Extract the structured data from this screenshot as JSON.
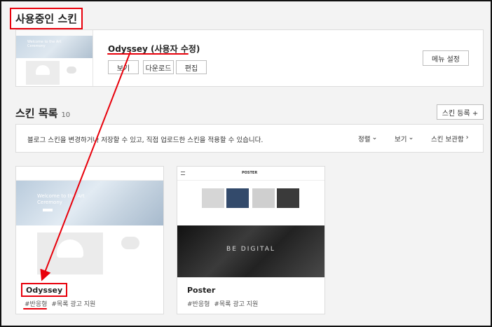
{
  "current": {
    "section_title": "사용중인 스킨",
    "skin_name": "Odyssey (사용자 수정)",
    "buttons": {
      "view": "보기",
      "download": "다운로드",
      "edit": "편집"
    },
    "menu_button": "메뉴 설정"
  },
  "thumb_text": {
    "hero": "Welcome to the Art Ceremony",
    "poster_hero": "BE DIGITAL",
    "poster_logo": "POSTER"
  },
  "list": {
    "title": "스킨 목록",
    "count": "10",
    "register_button": "스킨 등록 +",
    "info_text": "블로그 스킨을 변경하거나 저장할 수 있고, 직접 업로드한 스킨을 적용할 수 있습니다.",
    "sort": "정렬",
    "view": "보기",
    "storage": "스킨 보관함"
  },
  "skins": [
    {
      "name": "Odyssey",
      "tags": [
        "#반응형",
        "#목록 광고 지원"
      ]
    },
    {
      "name": "Poster",
      "tags": [
        "#반응형",
        "#목록 광고 지원"
      ]
    }
  ],
  "colors": {
    "annotation": "#e8000b"
  }
}
